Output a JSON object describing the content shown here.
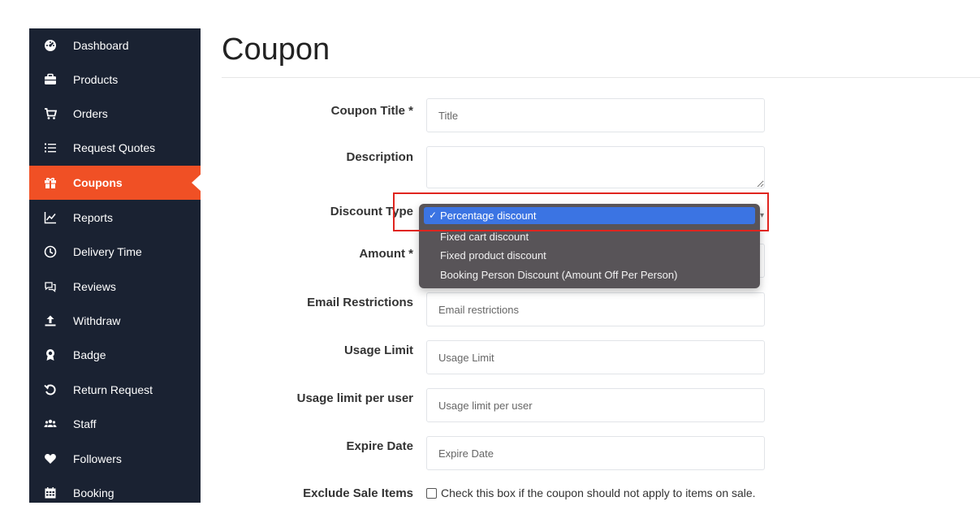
{
  "sidebar": {
    "items": [
      {
        "label": "Dashboard",
        "icon": "dashboard-icon"
      },
      {
        "label": "Products",
        "icon": "briefcase-icon"
      },
      {
        "label": "Orders",
        "icon": "cart-icon"
      },
      {
        "label": "Request Quotes",
        "icon": "list-icon"
      },
      {
        "label": "Coupons",
        "icon": "gift-icon"
      },
      {
        "label": "Reports",
        "icon": "chart-line-icon"
      },
      {
        "label": "Delivery Time",
        "icon": "clock-icon"
      },
      {
        "label": "Reviews",
        "icon": "comments-icon"
      },
      {
        "label": "Withdraw",
        "icon": "upload-icon"
      },
      {
        "label": "Badge",
        "icon": "badge-icon"
      },
      {
        "label": "Return Request",
        "icon": "undo-icon"
      },
      {
        "label": "Staff",
        "icon": "users-icon"
      },
      {
        "label": "Followers",
        "icon": "heart-icon"
      },
      {
        "label": "Booking",
        "icon": "calendar-icon"
      }
    ],
    "active": "Coupons",
    "colors": {
      "background": "#1a2232",
      "active": "#f05025"
    }
  },
  "page": {
    "title": "Coupon"
  },
  "form": {
    "coupon_title": {
      "label": "Coupon Title *",
      "placeholder": "Title"
    },
    "description": {
      "label": "Description",
      "placeholder": ""
    },
    "discount_type": {
      "label": "Discount Type",
      "selected": "Percentage discount",
      "options": [
        "Percentage discount",
        "Fixed cart discount",
        "Fixed product discount",
        "Booking Person Discount (Amount Off Per Person)"
      ]
    },
    "amount": {
      "label": "Amount *"
    },
    "email_restrictions": {
      "label": "Email Restrictions",
      "placeholder": "Email restrictions"
    },
    "usage_limit": {
      "label": "Usage Limit",
      "placeholder": "Usage Limit"
    },
    "usage_limit_per_user": {
      "label": "Usage limit per user",
      "placeholder": "Usage limit per user"
    },
    "expire_date": {
      "label": "Expire Date",
      "placeholder": "Expire Date"
    },
    "exclude_sale_items": {
      "label": "Exclude Sale Items",
      "checkbox_text": "Check this box if the coupon should not apply to items on sale.",
      "checked": false
    }
  },
  "highlight_color": "#e0251f",
  "selection_color": "#3b74e3"
}
